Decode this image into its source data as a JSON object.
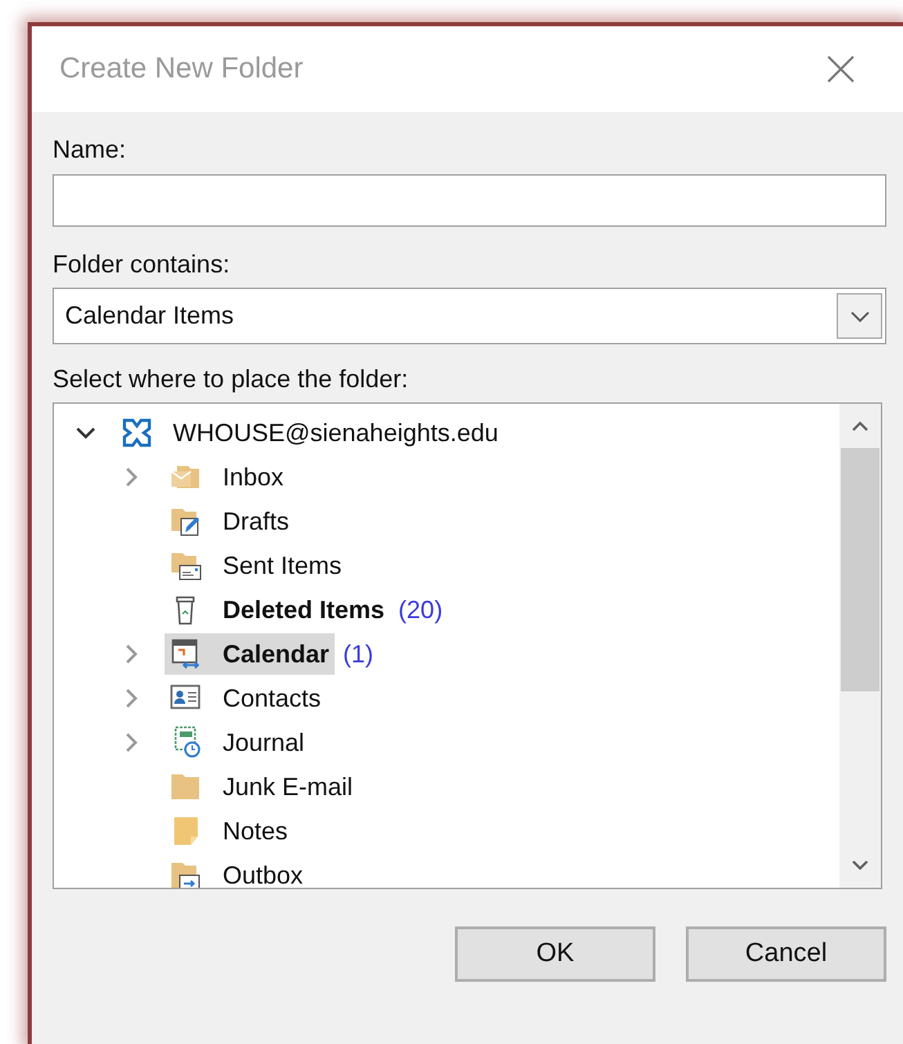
{
  "window": {
    "title": "Create New Folder"
  },
  "name_field": {
    "label": "Name:"
  },
  "folder_contains": {
    "label": "Folder contains:",
    "value": "Calendar Items"
  },
  "location": {
    "label": "Select where to place the folder:",
    "tree": [
      {
        "kind": "account",
        "label": "WHOUSE@sienaheights.edu",
        "expandable": true,
        "expanded": true,
        "bold": false,
        "selected": false,
        "children": [
          {
            "kind": "inbox",
            "label": "Inbox",
            "expandable": true,
            "expanded": false,
            "bold": false,
            "selected": false
          },
          {
            "kind": "drafts",
            "label": "Drafts",
            "expandable": false,
            "bold": false,
            "selected": false
          },
          {
            "kind": "sent",
            "label": "Sent Items",
            "expandable": false,
            "bold": false,
            "selected": false
          },
          {
            "kind": "deleted",
            "label": "Deleted Items",
            "count": "(20)",
            "expandable": false,
            "bold": true,
            "selected": false
          },
          {
            "kind": "calendar",
            "label": "Calendar",
            "count": "(1)",
            "expandable": true,
            "expanded": false,
            "bold": true,
            "selected": true
          },
          {
            "kind": "contacts",
            "label": "Contacts",
            "expandable": true,
            "expanded": false,
            "bold": false,
            "selected": false
          },
          {
            "kind": "journal",
            "label": "Journal",
            "expandable": true,
            "expanded": false,
            "bold": false,
            "selected": false
          },
          {
            "kind": "folder",
            "label": "Junk E-mail",
            "expandable": false,
            "bold": false,
            "selected": false
          },
          {
            "kind": "notes",
            "label": "Notes",
            "expandable": false,
            "bold": false,
            "selected": false
          },
          {
            "kind": "outbox",
            "label": "Outbox",
            "expandable": false,
            "bold": false,
            "selected": false
          }
        ]
      }
    ]
  },
  "buttons": [
    {
      "label": "OK"
    },
    {
      "label": "Cancel"
    }
  ]
}
